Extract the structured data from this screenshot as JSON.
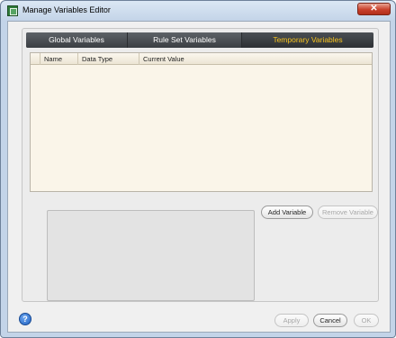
{
  "window": {
    "title": "Manage Variables Editor",
    "close_label": "✕"
  },
  "tabs": [
    {
      "label": "Global Variables",
      "active": false
    },
    {
      "label": "Rule Set Variables",
      "active": false
    },
    {
      "label": "Temporary Variables",
      "active": true
    }
  ],
  "grid": {
    "columns": [
      "Name",
      "Data Type",
      "Current Value"
    ],
    "rows": []
  },
  "actions": {
    "add_variable": "Add Variable",
    "remove_variable": "Remove Variable"
  },
  "footer": {
    "help_label": "?",
    "apply": "Apply",
    "cancel": "Cancel",
    "ok": "OK"
  },
  "colors": {
    "active_tab_text": "#f7c31f",
    "tab_bar": "#3a3e42",
    "grid_background": "#faf5e9"
  }
}
